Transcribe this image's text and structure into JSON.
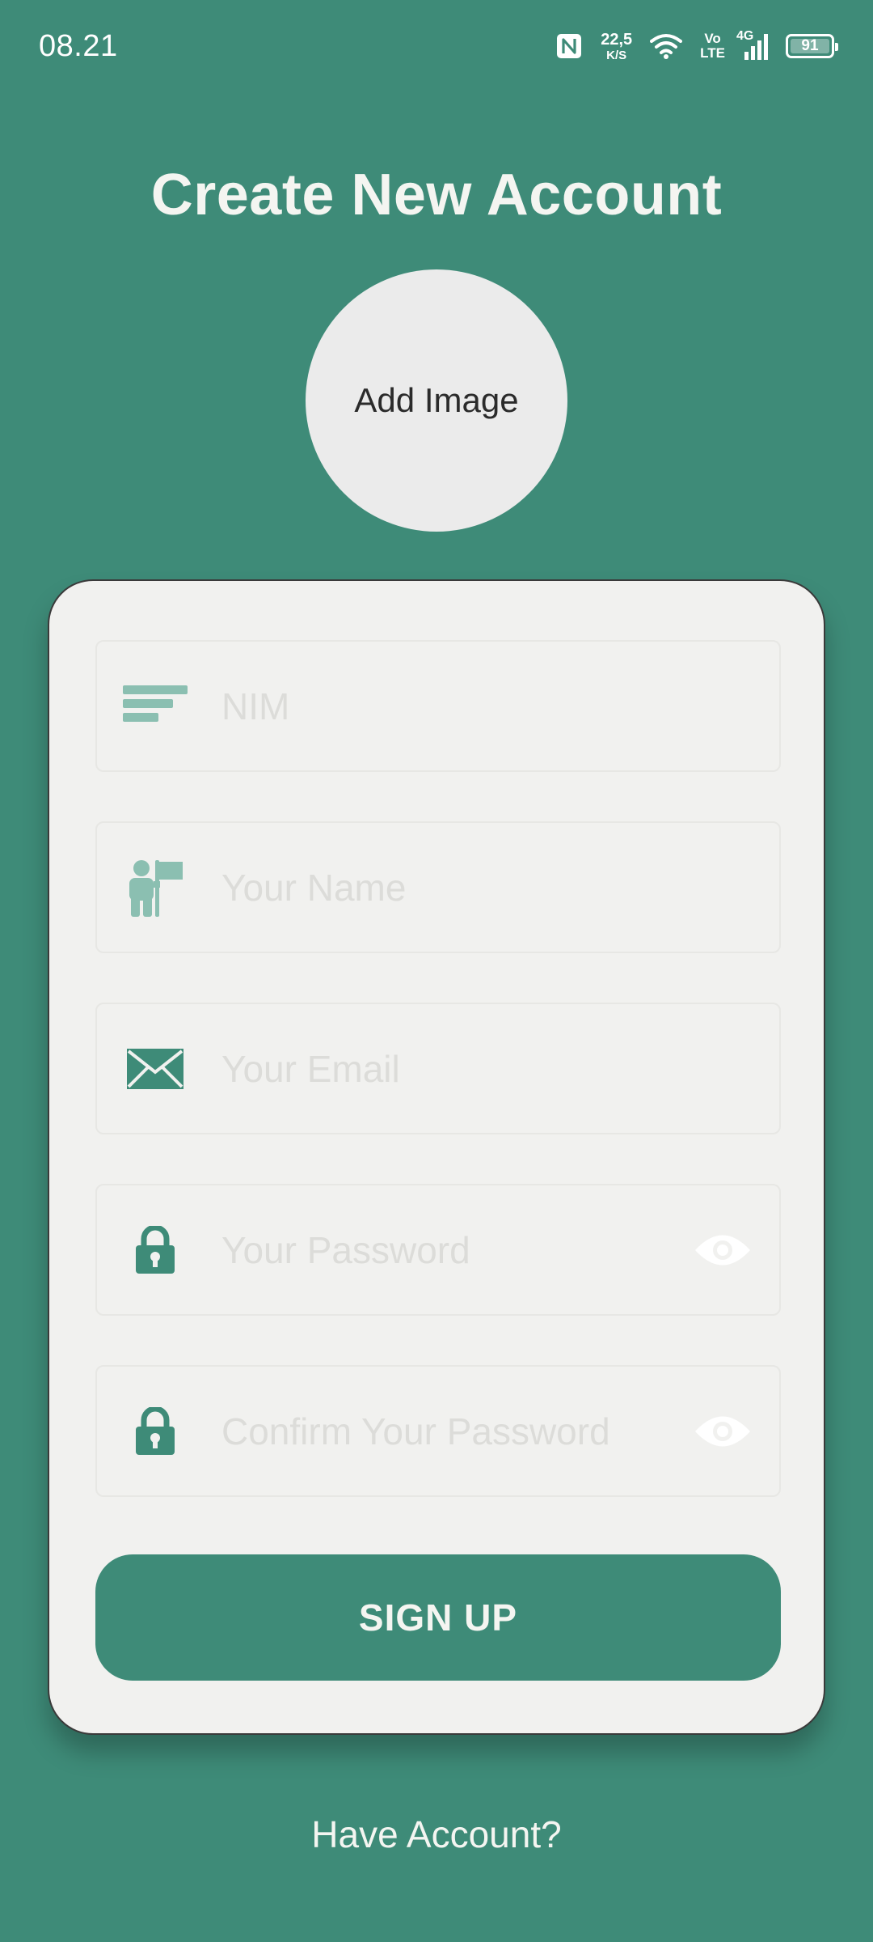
{
  "colors": {
    "brand": "#3e8b78",
    "card": "#f1f1ef",
    "icon_light": "#8bbfb1"
  },
  "status_bar": {
    "time": "08.21",
    "net_speed_value": "22,5",
    "net_speed_unit": "K/S",
    "volte_top": "Vo",
    "volte_bottom": "LTE",
    "network": "4G",
    "battery": "91"
  },
  "title": "Create New Account",
  "avatar": {
    "label": "Add Image"
  },
  "form": {
    "nim": {
      "placeholder": "NIM",
      "value": "",
      "icon": "sort-lines-icon"
    },
    "name": {
      "placeholder": "Your Name",
      "value": "",
      "icon": "person-flag-icon"
    },
    "email": {
      "placeholder": "Your Email",
      "value": "",
      "icon": "envelope-icon"
    },
    "password": {
      "placeholder": "Your Password",
      "value": "",
      "icon": "lock-icon",
      "toggle_icon": "eye-icon"
    },
    "confirm_password": {
      "placeholder": "Confirm Your Password",
      "value": "",
      "icon": "lock-icon",
      "toggle_icon": "eye-icon"
    }
  },
  "signup_button": {
    "label": "SIGN UP"
  },
  "footer": {
    "have_account": "Have Account?"
  }
}
